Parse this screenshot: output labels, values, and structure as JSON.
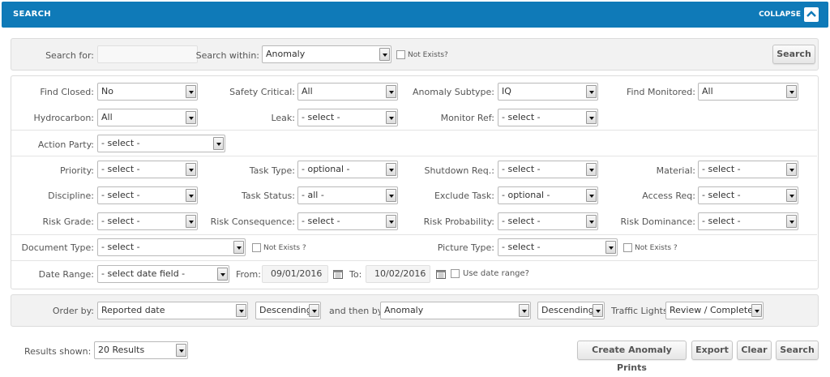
{
  "header": {
    "title": "SEARCH",
    "collapse_label": "COLLAPSE"
  },
  "search_bar": {
    "search_for_label": "Search for:",
    "search_for_value": "",
    "search_within_label": "Search within:",
    "search_within_value": "Anomaly",
    "not_exists_label": "Not Exists?",
    "search_button": "Search"
  },
  "filters": {
    "find_closed": {
      "label": "Find Closed:",
      "value": "No"
    },
    "safety_critical": {
      "label": "Safety Critical:",
      "value": "All"
    },
    "anomaly_subtype": {
      "label": "Anomaly Subtype:",
      "value": "IQ"
    },
    "find_monitored": {
      "label": "Find Monitored:",
      "value": "All"
    },
    "hydrocarbon": {
      "label": "Hydrocarbon:",
      "value": "All"
    },
    "leak": {
      "label": "Leak:",
      "value": "- select -"
    },
    "monitor_ref": {
      "label": "Monitor Ref:",
      "value": "- select -"
    },
    "action_party": {
      "label": "Action Party:",
      "value": "- select -"
    },
    "priority": {
      "label": "Priority:",
      "value": "- select -"
    },
    "task_type": {
      "label": "Task Type:",
      "value": "- optional -"
    },
    "shutdown_req": {
      "label": "Shutdown Req.:",
      "value": "- select -"
    },
    "material": {
      "label": "Material:",
      "value": "- select -"
    },
    "discipline": {
      "label": "Discipline:",
      "value": "- select -"
    },
    "task_status": {
      "label": "Task Status:",
      "value": "- all -"
    },
    "exclude_task": {
      "label": "Exclude Task:",
      "value": "- optional -"
    },
    "access_req": {
      "label": "Access Req:",
      "value": "- select -"
    },
    "risk_grade": {
      "label": "Risk Grade:",
      "value": "- select -"
    },
    "risk_consequence": {
      "label": "Risk Consequence:",
      "value": "- select -"
    },
    "risk_probability": {
      "label": "Risk Probability:",
      "value": "- select -"
    },
    "risk_dominance": {
      "label": "Risk Dominance:",
      "value": "- select -"
    },
    "document_type": {
      "label": "Document Type:",
      "value": "- select -",
      "not_exists": "Not Exists ?"
    },
    "picture_type": {
      "label": "Picture Type:",
      "value": "- select -",
      "not_exists": "Not Exists ?"
    },
    "date_range": {
      "label": "Date Range:",
      "value": "- select date field -",
      "from_label": "From:",
      "from_value": "09/01/2016",
      "to_label": "To:",
      "to_value": "10/02/2016",
      "use_label": "Use date range?"
    }
  },
  "order": {
    "order_by_label": "Order by:",
    "order_by_value": "Reported date",
    "direction1": "Descending",
    "then_by_label": "and then by:",
    "then_by_value": "Anomaly",
    "direction2": "Descending",
    "traffic_label": "Traffic Lights:",
    "traffic_value": "Review / Complete"
  },
  "footer": {
    "results_label": "Results shown:",
    "results_value": "20 Results",
    "create_prints": "Create Anomaly Prints",
    "export": "Export",
    "clear": "Clear",
    "search": "Search"
  },
  "colors": {
    "header_bg": "#0f7ab8"
  }
}
